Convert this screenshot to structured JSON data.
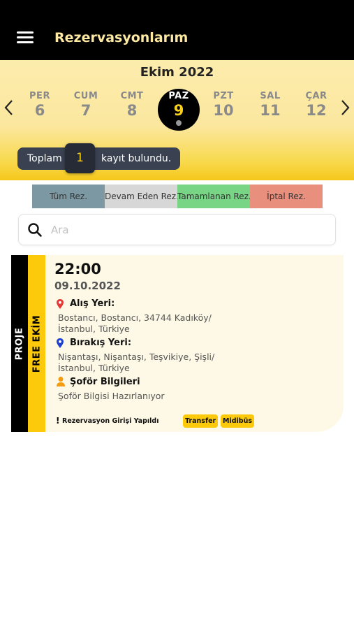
{
  "header": {
    "title": "Rezervasyonlarım"
  },
  "calendar": {
    "month": "Ekim 2022",
    "days": [
      {
        "name": "PER",
        "num": "6"
      },
      {
        "name": "CUM",
        "num": "7"
      },
      {
        "name": "CMT",
        "num": "8"
      },
      {
        "name": "PAZ",
        "num": "9"
      },
      {
        "name": "PZT",
        "num": "10"
      },
      {
        "name": "SAL",
        "num": "11"
      },
      {
        "name": "ÇAR",
        "num": "12"
      }
    ],
    "selected_index": 3
  },
  "summary": {
    "prefix": "Toplam",
    "count": "1",
    "suffix": "kayıt bulundu."
  },
  "filters": [
    "Tüm Rez.",
    "Devam Eden Rez.",
    "Tamamlanan Rez.",
    "İptal Rez."
  ],
  "search": {
    "placeholder": "Ara"
  },
  "reservation": {
    "side_label_1": "PROJE",
    "side_label_2": "FREE EKİM",
    "time": "22:00",
    "date": "09.10.2022",
    "pickup_label": "Alış Yeri:",
    "pickup_value": "Bostancı, Bostancı, 34744 Kadıköy/İstanbul, Türkiye",
    "dropoff_label": "Bırakış Yeri:",
    "dropoff_value": "Nişantaşı, Nişantaşı, Teşvikiye, Şişli/İstanbul, Türkiye",
    "driver_label": "Şoför Bilgileri",
    "driver_value": "Şoför Bilgisi Hazırlanıyor",
    "status_mark": "!",
    "status": "Rezervasyon Girişi Yapıldı",
    "tags": [
      "Transfer",
      "Midibüs"
    ]
  },
  "colors": {
    "header_bg": "#000000",
    "accent_yellow": "#fcca0a",
    "filter_all": "#7b98a3",
    "filter_ongoing": "#d7d7d7",
    "filter_done": "#77d585",
    "filter_cancel": "#e88f7d",
    "pickup_pin": "#e53935",
    "dropoff_pin": "#1e3fd1",
    "driver_icon": "#f39c12"
  },
  "icons": {
    "menu": "hamburger-menu-icon",
    "prev": "chevron-left-icon",
    "next": "chevron-right-icon",
    "search": "search-icon",
    "pickup": "location-pin-icon",
    "dropoff": "location-pin-icon",
    "driver": "driver-person-icon"
  }
}
